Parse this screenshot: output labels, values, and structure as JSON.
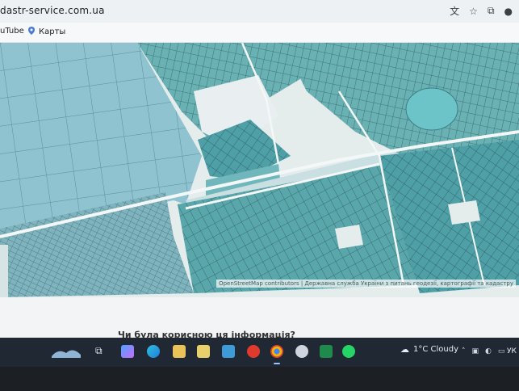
{
  "browser": {
    "url": "dastr-service.com.ua",
    "icons": [
      "translate-icon",
      "bookmark-star-icon",
      "extensions-icon",
      "profile-icon"
    ]
  },
  "bookmarks": [
    {
      "label": "uTube",
      "icon": "youtube-icon"
    },
    {
      "label": "Карты",
      "icon": "maps-icon"
    }
  ],
  "map": {
    "attribution": "OpenStreetMap contributors | Державна служба України з питань геодезії, картографії та кадастру"
  },
  "page": {
    "question": "Чи була корисною ця інформація?"
  },
  "taskbar": {
    "weather_text": "1°C  Cloudy",
    "language": "УК",
    "apps": [
      "file-explorer-icon",
      "copilot-icon",
      "edge-icon",
      "folder-icon",
      "store-icon",
      "app-icon",
      "opera-icon",
      "chrome-icon",
      "app-icon",
      "excel-icon",
      "whatsapp-icon"
    ]
  }
}
